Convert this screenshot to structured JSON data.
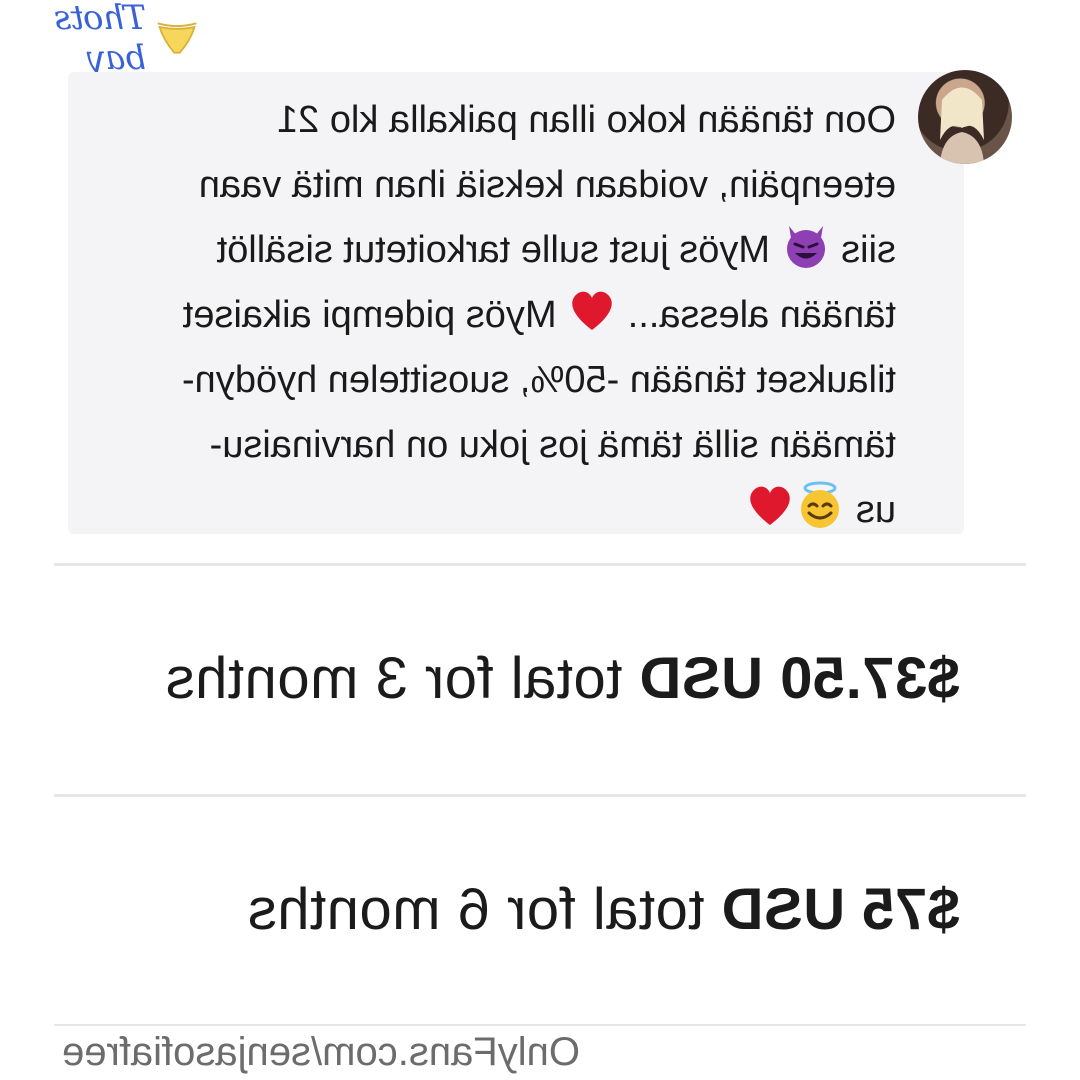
{
  "watermark": {
    "text": "Thots bay",
    "icon": "bikini-bottom-icon"
  },
  "message": {
    "avatar": "profile-photo",
    "line1": "Oon tänään koko illan paikalla klo 21",
    "line2": "eteenpäin, voidaan keksiä ihan mitä vaan",
    "line3_pre": "siis",
    "line3_emoji": "smiling-devil-emoji",
    "line3_post": "Myös just sulle tarkoitetut sisällöt",
    "line4_pre": "tänään alessa...",
    "line4_emoji": "red-heart-emoji",
    "line4_post": "Myös pidempi aikaiset",
    "line5": "tilaukset tänään -50%, suosittelen hyödyn-",
    "line6": "tämään sillä tämä jos joku on harvinaisu-",
    "line7": "us",
    "line7_emojis": [
      "halo-smile-emoji",
      "red-heart-emoji"
    ]
  },
  "offers": [
    {
      "price": "$37.50 USD",
      "label": "total for 3 months"
    },
    {
      "price": "$75 USD",
      "label": "total for 6 months"
    }
  ],
  "footer": {
    "url": "OnlyFans.com/senjasofiafree"
  },
  "colors": {
    "bubble": "#f4f4f6",
    "text": "#1a1a1a",
    "watermark": "#3a62d8",
    "divider": "#e6e6ea"
  }
}
